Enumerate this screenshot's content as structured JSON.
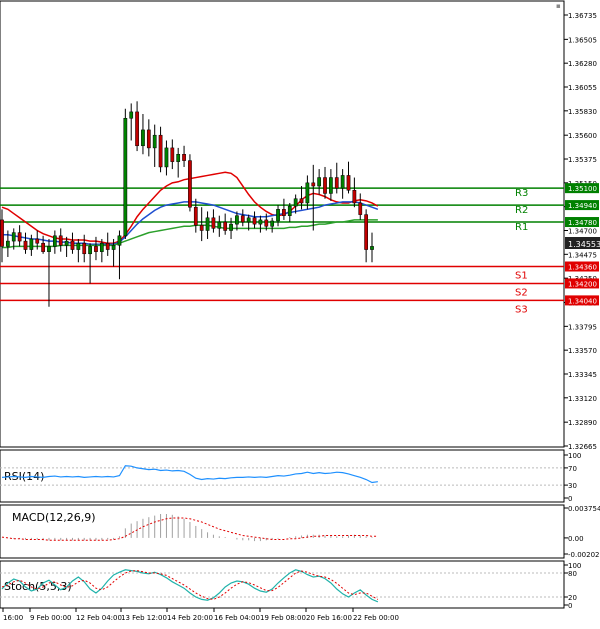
{
  "chart_data": [
    {
      "type": "candlestick",
      "ylim": [
        1.32665,
        1.36735
      ],
      "ytick_labels": [
        "1.36735",
        "1.36505",
        "1.36280",
        "1.36055",
        "1.35830",
        "1.35600",
        "1.35375",
        "1.35150",
        "1.34925",
        "1.34700",
        "1.34475",
        "1.34250",
        "1.34020",
        "1.33795",
        "1.33570",
        "1.33345",
        "1.33120",
        "1.32890",
        "1.32665"
      ],
      "ytick_values": [
        1.36735,
        1.36505,
        1.3628,
        1.36055,
        1.3583,
        1.356,
        1.35375,
        1.3515,
        1.34925,
        1.347,
        1.34475,
        1.3425,
        1.3402,
        1.33795,
        1.3357,
        1.33345,
        1.3312,
        1.3289,
        1.32665
      ],
      "current_price": "1.34553",
      "levels": [
        {
          "name": "R3",
          "value": 1.351,
          "label": "1.35100",
          "color": "#008000"
        },
        {
          "name": "R2",
          "value": 1.3494,
          "label": "1.34940",
          "color": "#008000"
        },
        {
          "name": "R1",
          "value": 1.3478,
          "label": "1.34780",
          "color": "#008000"
        },
        {
          "name": "S1",
          "value": 1.3436,
          "label": "1.34360",
          "color": "#e00000"
        },
        {
          "name": "S2",
          "value": 1.342,
          "label": "1.34200",
          "color": "#e00000"
        },
        {
          "name": "S3",
          "value": 1.3404,
          "label": "1.34040",
          "color": "#e00000"
        }
      ],
      "candles": [
        [
          1.348,
          1.349,
          1.344,
          1.3455
        ],
        [
          1.3455,
          1.347,
          1.3445,
          1.346
        ],
        [
          1.346,
          1.3472,
          1.3452,
          1.3468
        ],
        [
          1.3468,
          1.3475,
          1.3455,
          1.346
        ],
        [
          1.346,
          1.3468,
          1.3448,
          1.3452
        ],
        [
          1.3452,
          1.3466,
          1.3446,
          1.3462
        ],
        [
          1.3462,
          1.347,
          1.3452,
          1.3458
        ],
        [
          1.3458,
          1.3465,
          1.3448,
          1.345
        ],
        [
          1.345,
          1.3462,
          1.3398,
          1.3455
        ],
        [
          1.3455,
          1.347,
          1.3448,
          1.3465
        ],
        [
          1.3465,
          1.3472,
          1.345,
          1.3456
        ],
        [
          1.3456,
          1.3464,
          1.3445,
          1.346
        ],
        [
          1.346,
          1.3468,
          1.3448,
          1.3452
        ],
        [
          1.3452,
          1.3462,
          1.344,
          1.3458
        ],
        [
          1.3458,
          1.3466,
          1.344,
          1.3448
        ],
        [
          1.3448,
          1.3458,
          1.342,
          1.3455
        ],
        [
          1.3455,
          1.3464,
          1.3442,
          1.345
        ],
        [
          1.345,
          1.3462,
          1.344,
          1.3458
        ],
        [
          1.3458,
          1.3468,
          1.3446,
          1.3452
        ],
        [
          1.3452,
          1.3462,
          1.3436,
          1.3456
        ],
        [
          1.3456,
          1.347,
          1.3424,
          1.3465
        ],
        [
          1.3465,
          1.3585,
          1.3462,
          1.3576
        ],
        [
          1.3576,
          1.359,
          1.3555,
          1.3582
        ],
        [
          1.3582,
          1.3592,
          1.3545,
          1.355
        ],
        [
          1.355,
          1.358,
          1.3542,
          1.3565
        ],
        [
          1.3565,
          1.3575,
          1.354,
          1.3548
        ],
        [
          1.3548,
          1.357,
          1.353,
          1.356
        ],
        [
          1.356,
          1.3568,
          1.3525,
          1.353
        ],
        [
          1.353,
          1.3555,
          1.3522,
          1.3548
        ],
        [
          1.3548,
          1.3556,
          1.3528,
          1.3535
        ],
        [
          1.3535,
          1.3548,
          1.352,
          1.3542
        ],
        [
          1.3542,
          1.355,
          1.353,
          1.3536
        ],
        [
          1.3536,
          1.3542,
          1.3488,
          1.3492
        ],
        [
          1.3492,
          1.35,
          1.3468,
          1.3475
        ],
        [
          1.3475,
          1.3492,
          1.346,
          1.347
        ],
        [
          1.347,
          1.3488,
          1.3462,
          1.3482
        ],
        [
          1.3482,
          1.349,
          1.3468,
          1.3472
        ],
        [
          1.3472,
          1.3484,
          1.3464,
          1.3478
        ],
        [
          1.3478,
          1.3486,
          1.3466,
          1.347
        ],
        [
          1.347,
          1.3482,
          1.3462,
          1.3476
        ],
        [
          1.3476,
          1.3488,
          1.347,
          1.3484
        ],
        [
          1.3484,
          1.349,
          1.3474,
          1.3478
        ],
        [
          1.3478,
          1.3485,
          1.347,
          1.3482
        ],
        [
          1.3482,
          1.3488,
          1.3472,
          1.3476
        ],
        [
          1.3476,
          1.3484,
          1.3468,
          1.348
        ],
        [
          1.348,
          1.3486,
          1.347,
          1.3474
        ],
        [
          1.3474,
          1.3482,
          1.3468,
          1.3479
        ],
        [
          1.3479,
          1.3494,
          1.3474,
          1.349
        ],
        [
          1.349,
          1.35,
          1.348,
          1.3484
        ],
        [
          1.3484,
          1.3496,
          1.3478,
          1.3493
        ],
        [
          1.3493,
          1.3504,
          1.3486,
          1.35
        ],
        [
          1.35,
          1.3512,
          1.349,
          1.3496
        ],
        [
          1.3496,
          1.3522,
          1.349,
          1.3515
        ],
        [
          1.3515,
          1.3532,
          1.347,
          1.3512
        ],
        [
          1.3512,
          1.3528,
          1.3504,
          1.352
        ],
        [
          1.352,
          1.353,
          1.35,
          1.3505
        ],
        [
          1.3505,
          1.3528,
          1.3498,
          1.352
        ],
        [
          1.352,
          1.3534,
          1.3505,
          1.351
        ],
        [
          1.351,
          1.3528,
          1.35,
          1.3522
        ],
        [
          1.3522,
          1.3535,
          1.3505,
          1.3508
        ],
        [
          1.3508,
          1.352,
          1.3492,
          1.3496
        ],
        [
          1.3496,
          1.3505,
          1.348,
          1.3485
        ],
        [
          1.3485,
          1.349,
          1.344,
          1.3452
        ],
        [
          1.3452,
          1.3468,
          1.344,
          1.3455
        ]
      ],
      "ma_red": [
        1.3492,
        1.349,
        1.3486,
        1.3482,
        1.3478,
        1.3474,
        1.347,
        1.3467,
        1.3465,
        1.3463,
        1.3462,
        1.3462,
        1.3461,
        1.3461,
        1.3461,
        1.346,
        1.346,
        1.3459,
        1.3458,
        1.3458,
        1.346,
        1.3466,
        1.3474,
        1.3483,
        1.349,
        1.3496,
        1.3502,
        1.3508,
        1.3512,
        1.3515,
        1.3516,
        1.3518,
        1.3519,
        1.352,
        1.3521,
        1.3522,
        1.3523,
        1.3524,
        1.3525,
        1.3524,
        1.352,
        1.3512,
        1.3504,
        1.3497,
        1.3492,
        1.3488,
        1.3485,
        1.3484,
        1.3485,
        1.3488,
        1.3493,
        1.3499,
        1.3503,
        1.3505,
        1.3504,
        1.3502,
        1.3499,
        1.3497,
        1.3496,
        1.3496,
        1.3498,
        1.3499,
        1.3498,
        1.3496,
        1.3493
      ],
      "ma_blue": [
        1.3466,
        1.3466,
        1.3465,
        1.3464,
        1.3463,
        1.3462,
        1.3462,
        1.3461,
        1.346,
        1.346,
        1.3459,
        1.3459,
        1.3458,
        1.3458,
        1.3458,
        1.3457,
        1.3457,
        1.3457,
        1.3457,
        1.3457,
        1.3459,
        1.3464,
        1.347,
        1.3476,
        1.3481,
        1.3485,
        1.3489,
        1.3492,
        1.3494,
        1.3495,
        1.3496,
        1.3497,
        1.3497,
        1.3497,
        1.3496,
        1.3495,
        1.3494,
        1.3492,
        1.349,
        1.3488,
        1.3486,
        1.3485,
        1.3484,
        1.3483,
        1.3483,
        1.3483,
        1.3484,
        1.3485,
        1.3486,
        1.3487,
        1.3488,
        1.3489,
        1.349,
        1.3491,
        1.3492,
        1.3494,
        1.3495,
        1.3496,
        1.3497,
        1.3497,
        1.3497,
        1.3496,
        1.3494,
        1.3492,
        1.349
      ],
      "ma_green": [
        1.3454,
        1.3454,
        1.3455,
        1.3455,
        1.3455,
        1.3455,
        1.3455,
        1.3455,
        1.3455,
        1.3455,
        1.3456,
        1.3456,
        1.3456,
        1.3456,
        1.3456,
        1.3456,
        1.3456,
        1.3456,
        1.3456,
        1.3456,
        1.3458,
        1.346,
        1.3462,
        1.3464,
        1.3466,
        1.3468,
        1.3469,
        1.347,
        1.3471,
        1.3472,
        1.3473,
        1.3474,
        1.3474,
        1.3475,
        1.3475,
        1.3475,
        1.3474,
        1.3473,
        1.3472,
        1.3472,
        1.3472,
        1.3472,
        1.3472,
        1.3472,
        1.3472,
        1.3472,
        1.3472,
        1.3472,
        1.3472,
        1.3473,
        1.3473,
        1.3474,
        1.3474,
        1.3475,
        1.3476,
        1.3476,
        1.3477,
        1.3478,
        1.3478,
        1.3479,
        1.348,
        1.348,
        1.348,
        1.348,
        1.348
      ]
    },
    {
      "type": "line",
      "title": "RSI(14)",
      "ylim": [
        0,
        100
      ],
      "ytick_labels": [
        "100",
        "70",
        "30",
        "0"
      ],
      "ytick_values": [
        100,
        70,
        30,
        0
      ],
      "levels": [
        70,
        30
      ],
      "values": [
        48,
        49,
        50,
        49,
        48,
        50,
        49,
        48,
        50,
        51,
        49,
        50,
        49,
        50,
        48,
        49,
        50,
        49,
        50,
        49,
        52,
        75,
        74,
        70,
        68,
        66,
        67,
        64,
        65,
        63,
        64,
        62,
        55,
        46,
        43,
        45,
        44,
        46,
        45,
        47,
        48,
        48,
        49,
        48,
        49,
        48,
        50,
        52,
        51,
        53,
        56,
        57,
        60,
        57,
        59,
        57,
        58,
        60,
        59,
        56,
        52,
        48,
        43,
        36,
        38
      ]
    },
    {
      "type": "histogram",
      "title": "MACD(12,26,9)",
      "ylim": [
        -0.002021,
        0.003754
      ],
      "ytick_labels": [
        "0.003754",
        "0.00",
        "-0.002021"
      ],
      "ytick_values": [
        0.003754,
        0,
        -0.002021
      ],
      "histogram": [
        0,
        0,
        -0.0001,
        -0.0001,
        -0.0002,
        -0.0002,
        -0.0002,
        -0.0003,
        -0.0003,
        -0.0003,
        -0.0003,
        -0.0003,
        -0.0003,
        -0.0003,
        -0.0003,
        -0.0003,
        -0.0003,
        -0.0003,
        -0.0002,
        -0.0002,
        0.0002,
        0.0012,
        0.0018,
        0.0021,
        0.0024,
        0.0026,
        0.0028,
        0.003,
        0.003,
        0.0029,
        0.0027,
        0.0024,
        0.002,
        0.0015,
        0.0011,
        0.0007,
        0.0004,
        0.0002,
        0.0001,
        0,
        -0.0002,
        -0.0003,
        -0.0003,
        -0.0004,
        -0.0004,
        -0.0003,
        -0.0002,
        -0.0001,
        0,
        0.0001,
        0.0002,
        0.0003,
        0.0004,
        0.0004,
        0.0004,
        0.0003,
        0.0003,
        0.0002,
        0.0002,
        0.0003,
        0.0004,
        0.0003,
        0.0002,
        0.0001,
        0
      ],
      "signal": [
        0.0001,
        0,
        -0.0001,
        -0.0001,
        -0.0002,
        -0.0002,
        -0.0002,
        -0.0002,
        -0.0003,
        -0.0003,
        -0.0003,
        -0.0003,
        -0.0003,
        -0.0003,
        -0.0003,
        -0.0003,
        -0.0003,
        -0.0003,
        -0.0003,
        -0.0002,
        -0.0001,
        0.0002,
        0.0006,
        0.001,
        0.0014,
        0.0017,
        0.002,
        0.0022,
        0.0024,
        0.0025,
        0.0025,
        0.0025,
        0.0024,
        0.0022,
        0.002,
        0.0017,
        0.0014,
        0.0011,
        0.0009,
        0.0007,
        0.0005,
        0.0003,
        0.0002,
        0.0001,
        0,
        -0.0001,
        -0.0002,
        -0.0002,
        -0.0002,
        -0.0001,
        -0.0001,
        0,
        0.0001,
        0.0002,
        0.0002,
        0.0003,
        0.0003,
        0.0003,
        0.0003,
        0.0003,
        0.0003,
        0.0003,
        0.0003,
        0.0002,
        0.0002
      ]
    },
    {
      "type": "line",
      "title": "Stoch(5,5,3)",
      "ylim": [
        0,
        100
      ],
      "ytick_labels": [
        "100",
        "80",
        "20",
        "0"
      ],
      "ytick_values": [
        100,
        80,
        20,
        0
      ],
      "levels": [
        80,
        20
      ],
      "main": [
        40,
        55,
        65,
        60,
        45,
        35,
        40,
        55,
        62,
        50,
        38,
        45,
        60,
        70,
        58,
        40,
        30,
        42,
        60,
        75,
        82,
        88,
        86,
        84,
        80,
        78,
        82,
        76,
        68,
        58,
        50,
        42,
        30,
        20,
        14,
        12,
        18,
        30,
        45,
        55,
        60,
        58,
        52,
        42,
        35,
        32,
        40,
        55,
        68,
        80,
        88,
        84,
        76,
        70,
        72,
        66,
        55,
        40,
        28,
        20,
        30,
        38,
        25,
        14,
        8
      ],
      "signal": [
        45,
        50,
        58,
        62,
        55,
        45,
        40,
        45,
        55,
        58,
        50,
        44,
        48,
        58,
        62,
        55,
        42,
        38,
        45,
        58,
        70,
        80,
        85,
        86,
        83,
        80,
        80,
        78,
        74,
        66,
        58,
        50,
        40,
        30,
        22,
        16,
        14,
        20,
        30,
        42,
        52,
        58,
        56,
        50,
        43,
        36,
        36,
        44,
        56,
        68,
        80,
        85,
        82,
        76,
        72,
        70,
        64,
        54,
        42,
        30,
        26,
        30,
        30,
        22,
        14
      ],
      "xtick_labels": [
        "16:00",
        "9 Feb 00:00",
        "12 Feb 04:00",
        "13 Feb 12:00",
        "14 Feb 20:00",
        "16 Feb 04:00",
        "19 Feb 08:00",
        "20 Feb 16:00",
        "22 Feb 00:00"
      ]
    }
  ],
  "colors": {
    "up_candle": "#008000",
    "down_candle": "#c00000",
    "ma_red": "#e00000",
    "ma_blue": "#1f4fd0",
    "ma_green": "#2ca02c",
    "rsi_line": "#1e90ff",
    "macd_hist": "#a0a0a0",
    "macd_signal": "#e00000",
    "stoch_main": "#20b2aa",
    "stoch_signal": "#e00000",
    "current_price_bg": "#222222"
  }
}
